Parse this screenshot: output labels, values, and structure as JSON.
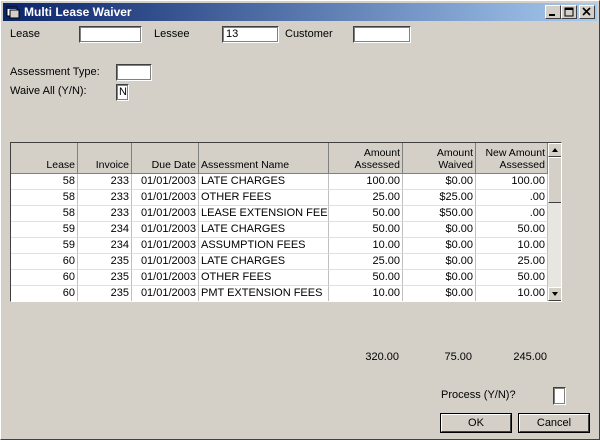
{
  "window": {
    "title": "Multi Lease Waiver"
  },
  "form": {
    "lease_label": "Lease",
    "lease_value": "",
    "lessee_label": "Lessee",
    "lessee_value": "13",
    "customer_label": "Customer",
    "customer_value": "",
    "assessment_type_label": "Assessment Type:",
    "assessment_type_value": "",
    "waive_all_label": "Waive All (Y/N):",
    "waive_all_value": "N"
  },
  "table": {
    "headers": {
      "lease": "Lease",
      "invoice": "Invoice",
      "due_date": "Due Date",
      "assessment_name": "Assessment Name",
      "amount_assessed_1": "Amount",
      "amount_assessed_2": "Assessed",
      "amount_waived_1": "Amount",
      "amount_waived_2": "Waived",
      "new_amount_1": "New Amount",
      "new_amount_2": "Assessed"
    },
    "rows": [
      {
        "lease": "58",
        "invoice": "233",
        "due_date": "01/01/2003",
        "name": "LATE CHARGES",
        "assessed": "100.00",
        "waived": "$0.00",
        "new_amount": "100.00"
      },
      {
        "lease": "58",
        "invoice": "233",
        "due_date": "01/01/2003",
        "name": "OTHER FEES",
        "assessed": "25.00",
        "waived": "$25.00",
        "new_amount": ".00"
      },
      {
        "lease": "58",
        "invoice": "233",
        "due_date": "01/01/2003",
        "name": "LEASE EXTENSION FEES",
        "assessed": "50.00",
        "waived": "$50.00",
        "new_amount": ".00"
      },
      {
        "lease": "59",
        "invoice": "234",
        "due_date": "01/01/2003",
        "name": "LATE CHARGES",
        "assessed": "50.00",
        "waived": "$0.00",
        "new_amount": "50.00"
      },
      {
        "lease": "59",
        "invoice": "234",
        "due_date": "01/01/2003",
        "name": "ASSUMPTION FEES",
        "assessed": "10.00",
        "waived": "$0.00",
        "new_amount": "10.00"
      },
      {
        "lease": "60",
        "invoice": "235",
        "due_date": "01/01/2003",
        "name": "LATE CHARGES",
        "assessed": "25.00",
        "waived": "$0.00",
        "new_amount": "25.00"
      },
      {
        "lease": "60",
        "invoice": "235",
        "due_date": "01/01/2003",
        "name": "OTHER FEES",
        "assessed": "50.00",
        "waived": "$0.00",
        "new_amount": "50.00"
      },
      {
        "lease": "60",
        "invoice": "235",
        "due_date": "01/01/2003",
        "name": "PMT EXTENSION FEES",
        "assessed": "10.00",
        "waived": "$0.00",
        "new_amount": "10.00"
      }
    ]
  },
  "totals": {
    "assessed": "320.00",
    "waived": "75.00",
    "new_amount": "245.00"
  },
  "process": {
    "label": "Process (Y/N)?",
    "value": ""
  },
  "buttons": {
    "ok": "OK",
    "cancel": "Cancel"
  },
  "icons": {
    "app": "app-window-icon",
    "minimize": "minimize-icon",
    "maximize": "maximize-icon",
    "close": "close-icon",
    "scroll_up": "arrow-up-icon",
    "scroll_down": "arrow-down-icon"
  },
  "colors": {
    "titlebar_start": "#0a246a",
    "titlebar_end": "#a6caf0",
    "face": "#d4d0c8"
  }
}
